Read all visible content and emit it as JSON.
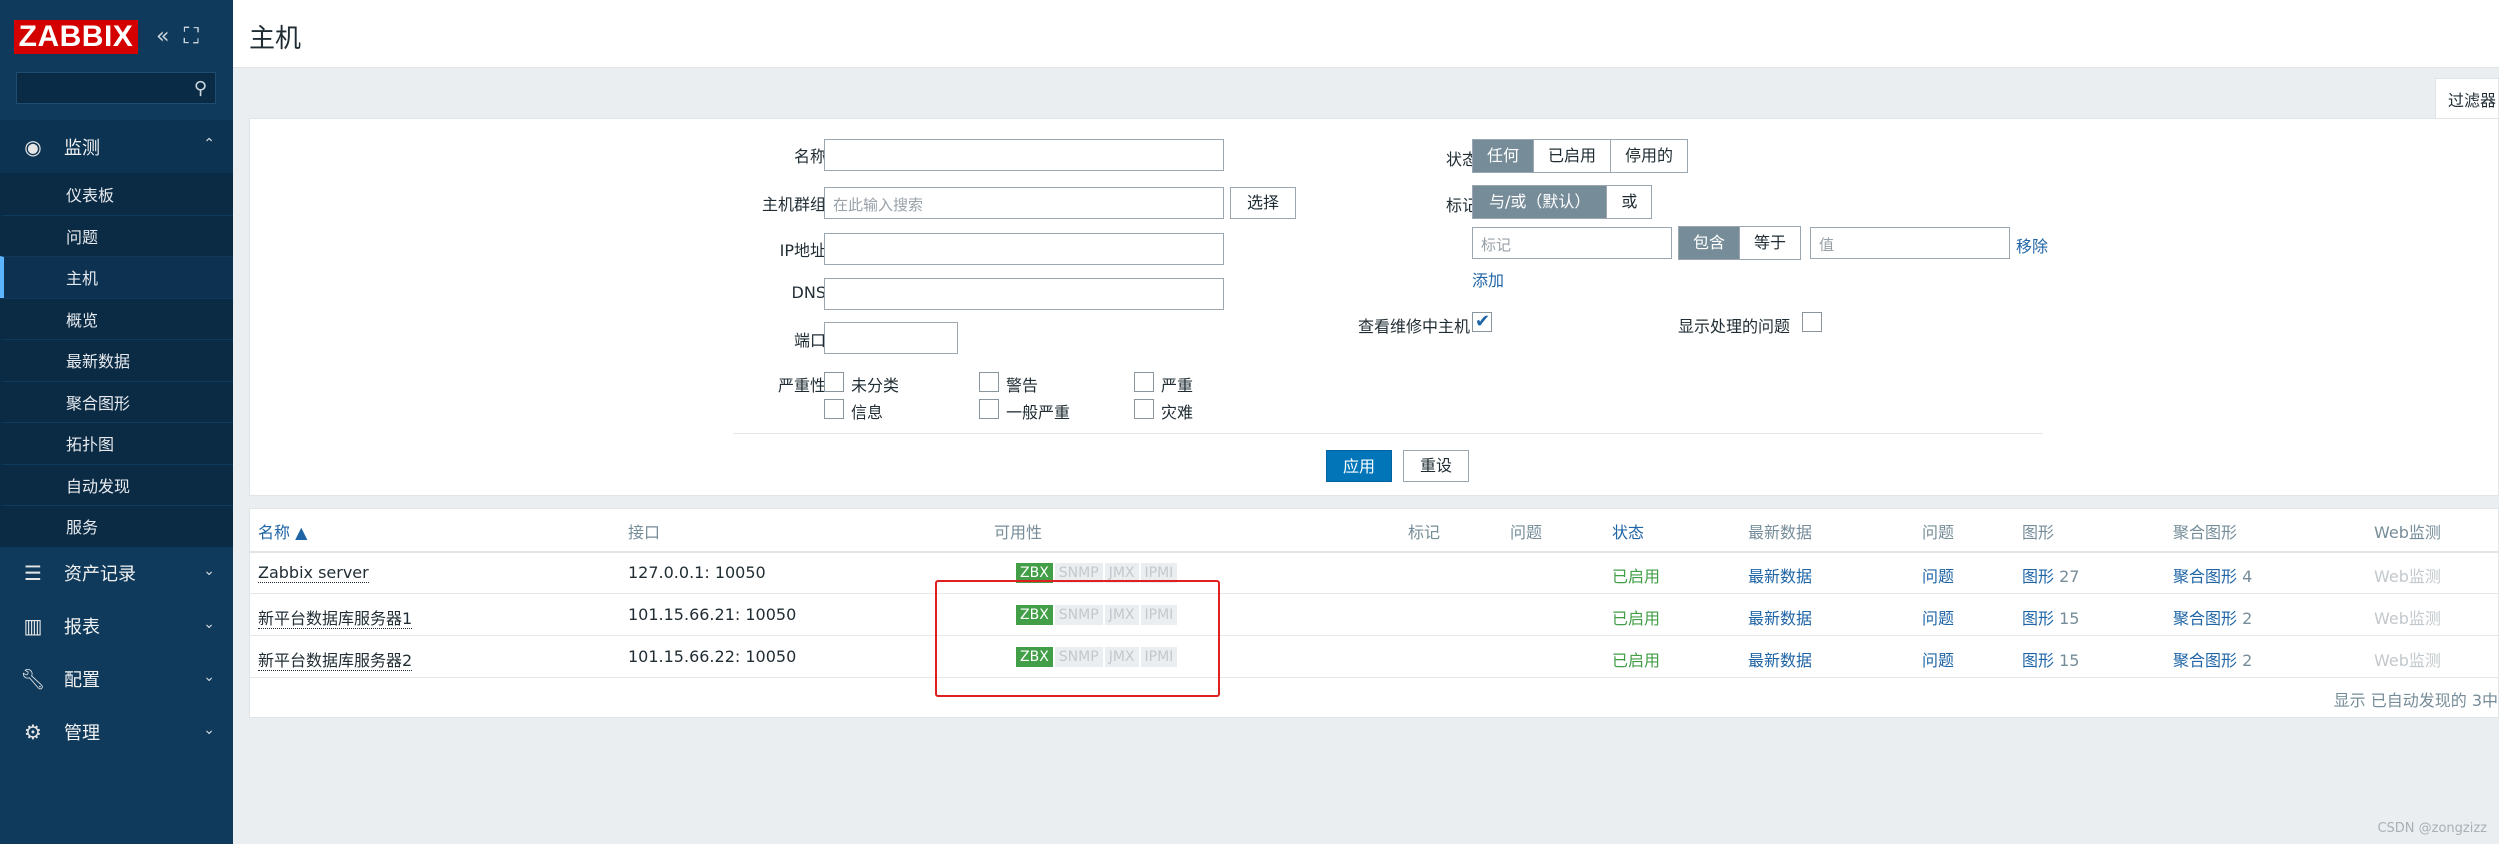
{
  "app": {
    "logo": "ZABBIX",
    "collapse_icon": "double-chevron-left-icon",
    "kiosk_icon": "kiosk-mode-icon",
    "search_icon": "search-icon"
  },
  "sidebar": {
    "menu": [
      {
        "label": "监测",
        "icon": "eye-icon",
        "open": true
      },
      {
        "label": "资产记录",
        "icon": "list-icon"
      },
      {
        "label": "报表",
        "icon": "bar-chart-icon"
      },
      {
        "label": "配置",
        "icon": "wrench-icon"
      },
      {
        "label": "管理",
        "icon": "gear-icon"
      }
    ],
    "submenu": [
      "仪表板",
      "问题",
      "主机",
      "概览",
      "最新数据",
      "聚合图形",
      "拓扑图",
      "自动发现",
      "服务"
    ],
    "active_submenu": "主机"
  },
  "page": {
    "title": "主机",
    "filter_tab": "过滤器"
  },
  "filter": {
    "name_label": "名称",
    "name_value": "",
    "hostgroup_label": "主机群组",
    "hostgroup_placeholder": "在此输入搜索",
    "select_button": "选择",
    "ip_label": "IP地址",
    "dns_label": "DNS",
    "port_label": "端口",
    "severity_label": "严重性",
    "severities": [
      "未分类",
      "警告",
      "严重",
      "信息",
      "一般严重",
      "灾难"
    ],
    "status_label": "状态",
    "status_options": [
      "任何",
      "已启用",
      "停用的"
    ],
    "status_selected": "任何",
    "tags_label": "标记",
    "tags_options": [
      "与/或（默认）",
      "或"
    ],
    "tag_placeholder": "标记",
    "tag_operator_options": [
      "包含",
      "等于"
    ],
    "value_placeholder": "值",
    "remove_link": "移除",
    "add_link": "添加",
    "maintenance_label": "查看维修中主机",
    "maintenance_checked": true,
    "suppressed_label": "显示处理的问题",
    "suppressed_checked": false,
    "apply_button": "应用",
    "reset_button": "重设"
  },
  "table": {
    "columns": [
      "名称 ▲",
      "接口",
      "可用性",
      "标记",
      "问题",
      "状态",
      "最新数据",
      "问题",
      "图形",
      "聚合图形",
      "Web监测"
    ],
    "rows": [
      {
        "name": "Zabbix server",
        "interface": "127.0.0.1: 10050",
        "availability": [
          "ZBX",
          "SNMP",
          "JMX",
          "IPMI"
        ],
        "status": "已启用",
        "latest": "最新数据",
        "problems": "问题",
        "graphs": "图形",
        "graphs_count": "27",
        "screens": "聚合图形",
        "screens_count": "4",
        "web": "Web监测"
      },
      {
        "name": "新平台数据库服务器1",
        "interface": "101.15.66.21: 10050",
        "availability": [
          "ZBX",
          "SNMP",
          "JMX",
          "IPMI"
        ],
        "status": "已启用",
        "latest": "最新数据",
        "problems": "问题",
        "graphs": "图形",
        "graphs_count": "15",
        "screens": "聚合图形",
        "screens_count": "2",
        "web": "Web监测"
      },
      {
        "name": "新平台数据库服务器2",
        "interface": "101.15.66.22: 10050",
        "availability": [
          "ZBX",
          "SNMP",
          "JMX",
          "IPMI"
        ],
        "status": "已启用",
        "latest": "最新数据",
        "problems": "问题",
        "graphs": "图形",
        "graphs_count": "15",
        "screens": "聚合图形",
        "screens_count": "2",
        "web": "Web监测"
      }
    ],
    "footer": "显示 已自动发现的 3中"
  },
  "watermark": "CSDN @zongzizz",
  "colors": {
    "sidebar_bg": "#0f3a5c",
    "logo_red": "#d40000",
    "primary_blue": "#0275b8",
    "link_blue": "#1f65a6",
    "enabled_green": "#429e47",
    "highlight_red": "#e02020"
  }
}
